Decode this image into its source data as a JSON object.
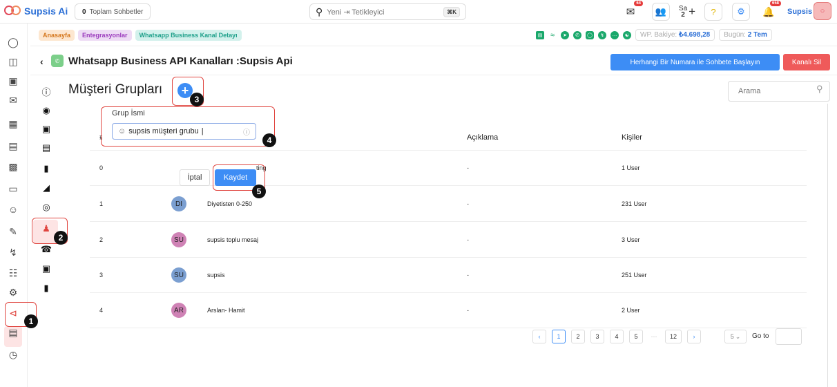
{
  "app": {
    "name": "Supsis Ai"
  },
  "topbar": {
    "chat_count_label": "0",
    "chat_count_text": "Toplam Sohbetler",
    "search_placeholder": "Yeni ⇥ Tetikleyici",
    "search_shortcut": "⌘K",
    "mail_badge": "64",
    "notify_badge": "658",
    "user_initials": "Sa",
    "user_count": "2",
    "user_name": "Supsis"
  },
  "breadcrumb": [
    "Anasayfa",
    "Entegrasyonlar",
    "Whatsapp Business Kanal Detayı"
  ],
  "balance": {
    "label": "WP. Bakiye:",
    "value": "₺4.698,28",
    "today_label": "Bugün:",
    "today_value": "2 Tem"
  },
  "header": {
    "title": "Whatsapp Business API Kanalları :Supsis Api",
    "start_chat_button": "Herhangi Bir Numara ile Sohbete Başlayın",
    "delete_button": "Kanalı Sil"
  },
  "section": {
    "title": "Müşteri Grupları",
    "search_placeholder": "Arama"
  },
  "form": {
    "label": "Grup İsmi",
    "value": "supsis müşteri grubu",
    "cancel": "İptal",
    "save": "Kaydet"
  },
  "table": {
    "columns": [
      "#",
      "Açıklama",
      "Kişiler"
    ],
    "partial_name": "ting",
    "rows": [
      {
        "idx": "0",
        "initials": "",
        "name": "",
        "desc": "-",
        "users": "1 User",
        "color": ""
      },
      {
        "idx": "1",
        "initials": "DI",
        "name": "Diyetisten 0-250",
        "desc": "-",
        "users": "231 User",
        "color": "#7b9fd1"
      },
      {
        "idx": "2",
        "initials": "SU",
        "name": "supsis toplu mesaj",
        "desc": "-",
        "users": "3 User",
        "color": "#cf82b5"
      },
      {
        "idx": "3",
        "initials": "SU",
        "name": "supsis",
        "desc": "-",
        "users": "251 User",
        "color": "#7b9fd1"
      },
      {
        "idx": "4",
        "initials": "AR",
        "name": "Arslan- Hamit",
        "desc": "-",
        "users": "2 User",
        "color": "#cf82b5"
      }
    ]
  },
  "pagination": {
    "pages": [
      "1",
      "2",
      "3",
      "4",
      "5",
      "12"
    ],
    "dots": "···",
    "page_size": "5",
    "goto": "Go to"
  },
  "annotations": [
    "1",
    "2",
    "3",
    "4",
    "5"
  ],
  "colors": {
    "accent": "#3d8df5",
    "danger": "#ef5a5a",
    "annotation": "#e0453f"
  }
}
